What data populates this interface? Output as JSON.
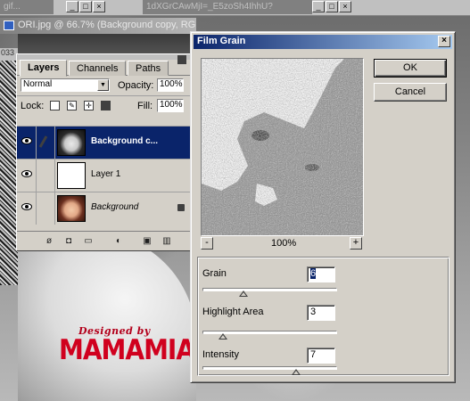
{
  "top_strip": {
    "tab1": "gif...",
    "tab2": "1dXGrCAwMjI=_E5zoSh4IhhU?"
  },
  "document": {
    "title": "ORI.jpg @ 66.7% (Background copy, RGB)",
    "side_number": "033"
  },
  "layers_palette": {
    "tabs": [
      {
        "label": "Layers"
      },
      {
        "label": "Channels"
      },
      {
        "label": "Paths"
      }
    ],
    "blend_mode": "Normal",
    "opacity_label": "Opacity:",
    "opacity_value": "100%",
    "lock_label": "Lock:",
    "fill_label": "Fill:",
    "fill_value": "100%",
    "layers": [
      {
        "name": "Background c...",
        "selected": true
      },
      {
        "name": "Layer 1",
        "selected": false
      },
      {
        "name": "Background",
        "selected": false
      }
    ]
  },
  "watermark": {
    "line1": "Designed by",
    "line2": "MAMAMIA"
  },
  "dialog": {
    "title": "Film Grain",
    "close_glyph": "×",
    "ok_label": "OK",
    "cancel_label": "Cancel",
    "zoom_minus": "-",
    "zoom_plus": "+",
    "zoom_value": "100%",
    "params": [
      {
        "label": "Grain",
        "value": "6",
        "level": 0.3
      },
      {
        "label": "Highlight Area",
        "value": "3",
        "level": 0.15
      },
      {
        "label": "Intensity",
        "value": "7",
        "level": 0.7
      }
    ]
  }
}
